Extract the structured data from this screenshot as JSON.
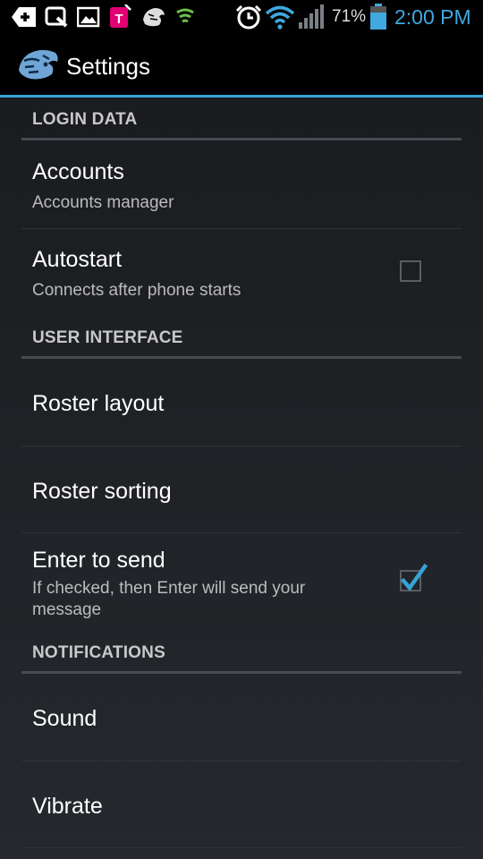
{
  "status_bar": {
    "battery_percent": "71%",
    "clock": "2:00 PM",
    "icons": [
      "add-notification-icon",
      "search-notification-icon",
      "image-icon",
      "t-mobile-icon",
      "tiger-app-icon",
      "tiger-app-icon",
      "vpn-shield-icon",
      "alarm-icon",
      "wifi-icon",
      "signal-icon",
      "battery-icon"
    ]
  },
  "action_bar": {
    "title": "Settings",
    "icon": "tiger-logo-icon"
  },
  "sections": {
    "login_data": {
      "header": "LOGIN DATA",
      "accounts": {
        "title": "Accounts",
        "summary": "Accounts manager"
      },
      "autostart": {
        "title": "Autostart",
        "summary": "Connects after phone starts",
        "checked": false
      }
    },
    "user_interface": {
      "header": "USER INTERFACE",
      "roster_layout": {
        "title": "Roster layout"
      },
      "roster_sorting": {
        "title": "Roster sorting"
      },
      "enter_to_send": {
        "title": "Enter to send",
        "summary": "If checked, then Enter will send your message",
        "checked": true
      }
    },
    "notifications": {
      "header": "NOTIFICATIONS",
      "sound": {
        "title": "Sound"
      },
      "vibrate": {
        "title": "Vibrate"
      }
    }
  },
  "colors": {
    "accent": "#35a3d6",
    "clock": "#3fa9e0",
    "background": "#1b1d20",
    "category_text": "#c8c8c8"
  }
}
